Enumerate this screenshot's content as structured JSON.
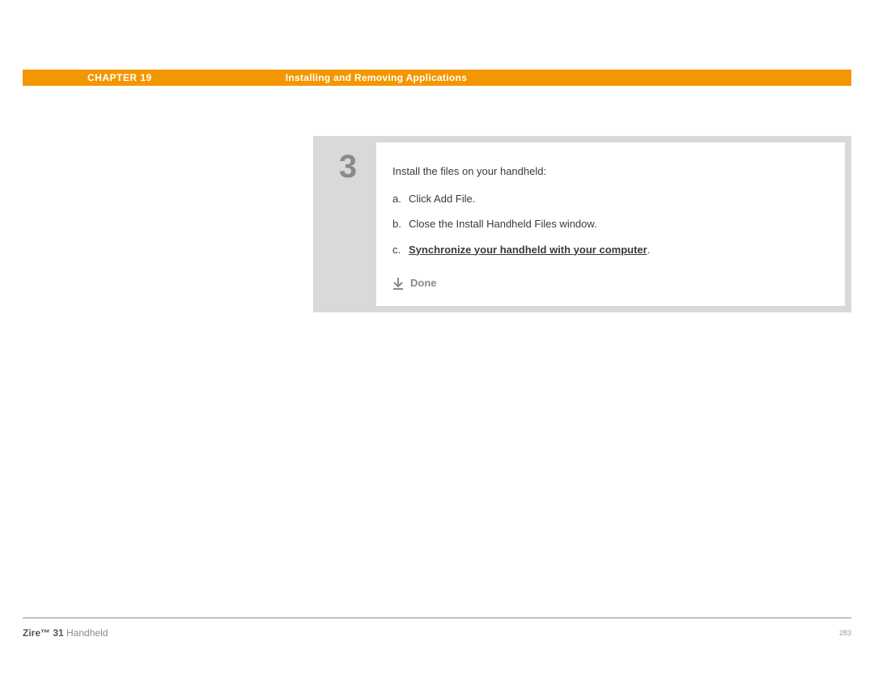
{
  "header": {
    "chapter_label": "CHAPTER 19",
    "chapter_title": "Installing and Removing Applications"
  },
  "step": {
    "number": "3",
    "intro": "Install the files on your handheld:",
    "substeps": {
      "a": {
        "marker": "a.",
        "text": "Click Add File."
      },
      "b": {
        "marker": "b.",
        "text": "Close the Install Handheld Files window."
      },
      "c": {
        "marker": "c.",
        "link_text": "Synchronize your handheld with your computer",
        "trailing": "."
      }
    },
    "done_label": "Done"
  },
  "footer": {
    "product_bold": "Zire™ 31",
    "product_rest": " Handheld",
    "page": "283"
  }
}
